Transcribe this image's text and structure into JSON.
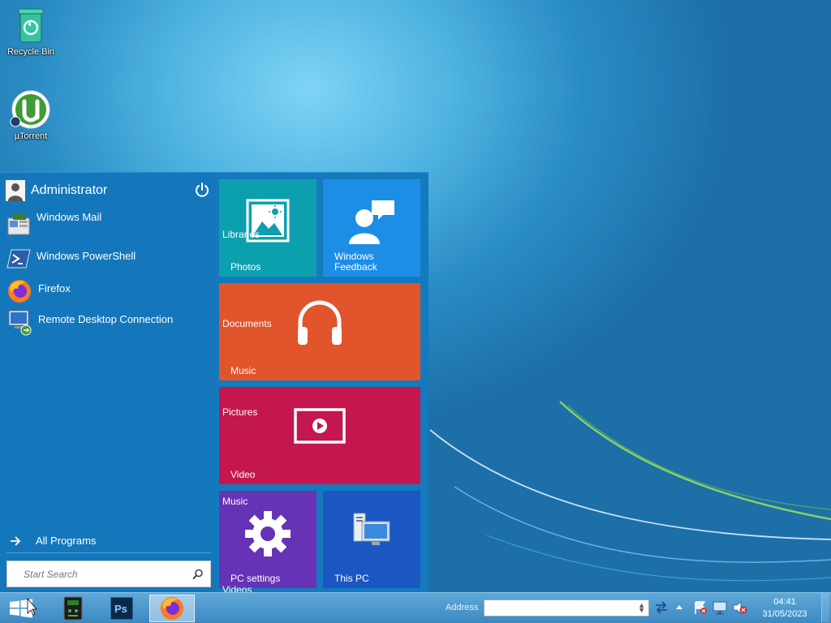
{
  "desktop": {
    "icons": [
      {
        "label": "Recycle Bin",
        "icon": "recycle-bin-icon"
      },
      {
        "label": "µTorrent",
        "icon": "utorrent-icon"
      }
    ]
  },
  "start_menu": {
    "user": {
      "name": "Administrator",
      "icon": "user-icon"
    },
    "power_icon": "power-icon",
    "programs": [
      {
        "label": "Windows Mail",
        "icon": "windows-mail-icon"
      },
      {
        "label": "Windows PowerShell",
        "icon": "powershell-icon"
      },
      {
        "label": "Firefox",
        "icon": "firefox-icon"
      },
      {
        "label": "Remote Desktop Connection",
        "icon": "remote-desktop-icon"
      }
    ],
    "all_programs": "All Programs",
    "search_placeholder": "Start Search",
    "tiles": {
      "photos": {
        "label": "Photos",
        "ghost": "Libraries",
        "color": "#0ca0ae"
      },
      "feedback": {
        "label_line1": "Windows",
        "label_line2": "Feedback",
        "color": "#1d8ee6"
      },
      "music": {
        "label": "Music",
        "ghost": "Documents",
        "color": "#e2542b"
      },
      "video": {
        "label": "Video",
        "ghost": "Pictures",
        "color": "#c4174e"
      },
      "settings": {
        "label": "PC settings",
        "ghost": "Music",
        "overflow": "Videos",
        "color": "#6633b6"
      },
      "thispc": {
        "label": "This PC",
        "color": "#1b57c2"
      }
    }
  },
  "taskbar": {
    "apps": [
      "app-icon",
      "photoshop-icon",
      "firefox-icon"
    ],
    "photoshop_text": "Ps",
    "address_label": "Address",
    "address_value": "",
    "time": "04:41",
    "date": "31/05/2023"
  }
}
